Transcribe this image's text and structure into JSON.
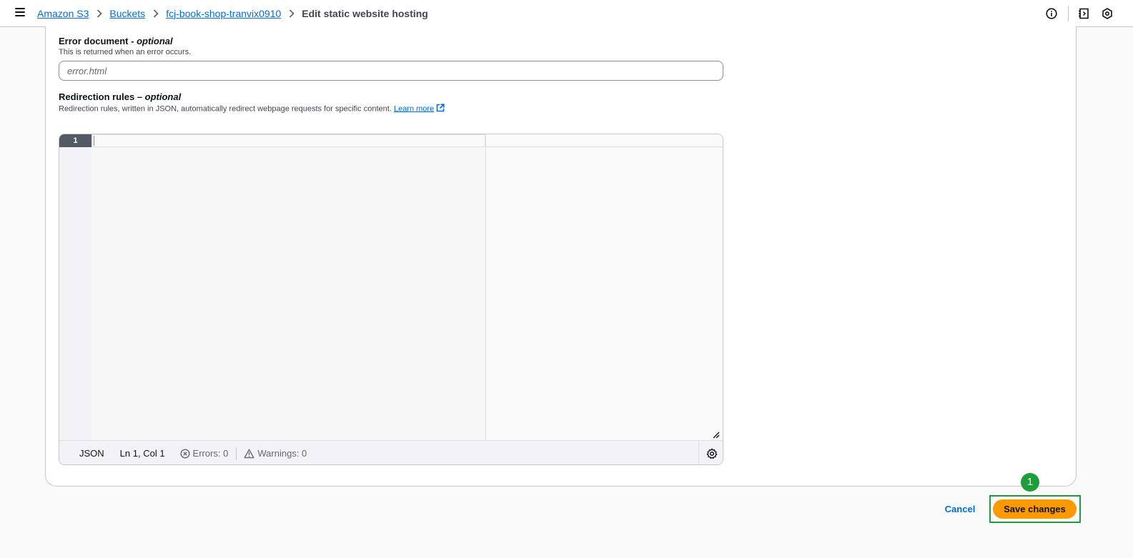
{
  "breadcrumb": {
    "items": [
      "Amazon S3",
      "Buckets",
      "fcj-book-shop-tranvix0910"
    ],
    "current": "Edit static website hosting"
  },
  "topbar_icons": [
    "info-icon",
    "notes-icon",
    "settings-hex-icon"
  ],
  "error_document": {
    "label": "Error document",
    "label_suffix": "optional",
    "separator": " - ",
    "description": "This is returned when an error occurs.",
    "placeholder": "error.html",
    "value": ""
  },
  "redirection_rules": {
    "label": "Redirection rules",
    "label_suffix": "optional",
    "separator": " – ",
    "description": "Redirection rules, written in JSON, automatically redirect webpage requests for specific content.",
    "learn_more": "Learn more"
  },
  "editor": {
    "line_number": "1",
    "language": "JSON",
    "position": "Ln 1, Col 1",
    "errors": "Errors: 0",
    "warnings": "Warnings: 0"
  },
  "actions": {
    "cancel": "Cancel",
    "save": "Save changes",
    "step_badge": "1"
  },
  "colors": {
    "link": "#006ce0",
    "primary_button": "#ff9900",
    "highlight": "#1e9e3a"
  }
}
